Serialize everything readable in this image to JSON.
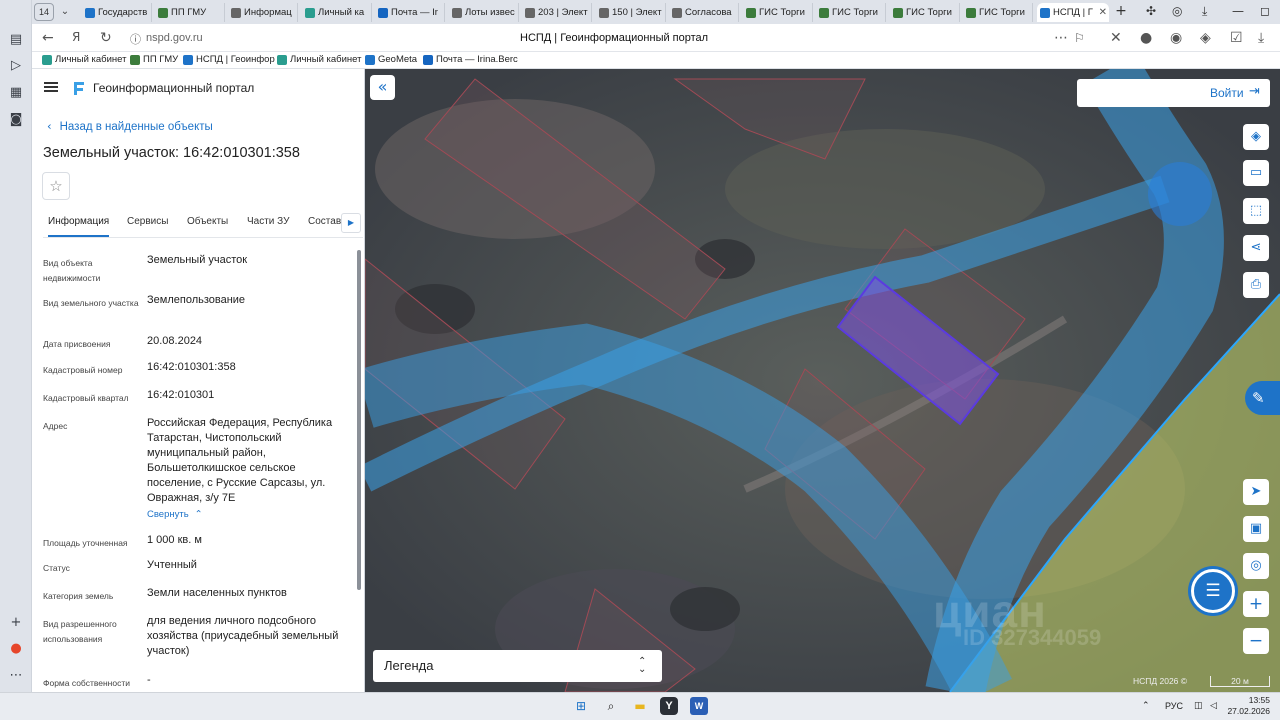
{
  "browser": {
    "tab_count": "14",
    "tabs": [
      {
        "label": "Государств",
        "color": "#1e73c8"
      },
      {
        "label": "ПП ГМУ",
        "color": "#3c7c3c"
      },
      {
        "label": "Информац",
        "color": "#666666"
      },
      {
        "label": "Личный ка",
        "color": "#2a9d8f"
      },
      {
        "label": "Почта — Ir",
        "color": "#1565c0"
      },
      {
        "label": "Лоты извес",
        "color": "#666666"
      },
      {
        "label": "203 | Элект",
        "color": "#666666"
      },
      {
        "label": "150 | Элект",
        "color": "#666666"
      },
      {
        "label": "Согласова",
        "color": "#666666"
      },
      {
        "label": "ГИС Торги",
        "color": "#3c7c3c"
      },
      {
        "label": "ГИС Торги",
        "color": "#3c7c3c"
      },
      {
        "label": "ГИС Торги",
        "color": "#3c7c3c"
      },
      {
        "label": "ГИС Торги",
        "color": "#3c7c3c"
      },
      {
        "label": "НСПД | Г",
        "color": "#1e73c8",
        "active": true
      }
    ],
    "url": "nspd.gov.ru",
    "page_title": "НСПД | Геоинформационный портал",
    "bookmarks": [
      {
        "label": "Личный кабинет",
        "color": "#2a9d8f"
      },
      {
        "label": "ПП ГМУ",
        "color": "#3c7c3c"
      },
      {
        "label": "НСПД | Геоинфор",
        "color": "#1e73c8"
      },
      {
        "label": "Личный кабинет",
        "color": "#2a9d8f"
      },
      {
        "label": "GeoMeta",
        "color": "#1e73c8"
      },
      {
        "label": "Почта — Irina.Berс",
        "color": "#1565c0"
      }
    ]
  },
  "panel": {
    "portal_title": "Геоинформационный портал",
    "back_label": "Назад в найденные объекты",
    "object_title": "Земельный участок: 16:42:010301:358",
    "tabs": [
      "Информация",
      "Сервисы",
      "Объекты",
      "Части ЗУ",
      "Состав"
    ],
    "fields": [
      {
        "key": "Вид объекта недвижимости",
        "value": "Земельный участок"
      },
      {
        "key": "Вид земельного участка",
        "value": "Землепользование"
      },
      {
        "key": "Дата присвоения",
        "value": "20.08.2024"
      },
      {
        "key": "Кадастровый номер",
        "value": "16:42:010301:358"
      },
      {
        "key": "Кадастровый квартал",
        "value": "16:42:010301"
      },
      {
        "key": "Адрес",
        "value": "Российская Федерация, Республика Татарстан, Чистопольский муниципальный район, Большетолкишское сельское поселение, с Русские Сарсазы, ул. Овражная, з/у 7Е"
      },
      {
        "key": "Площадь уточненная",
        "value": "1 000 кв. м"
      },
      {
        "key": "Статус",
        "value": "Учтенный"
      },
      {
        "key": "Категория земель",
        "value": "Земли населенных пунктов"
      },
      {
        "key": "Вид разрешенного использования",
        "value": "для ведения личного подсобного хозяйства (приусадебный земельный участок)"
      },
      {
        "key": "Форма собственности",
        "value": "-"
      }
    ],
    "collapse_label": "Свернуть"
  },
  "map": {
    "login_label": "Войти",
    "legend_label": "Легенда",
    "attribution": "НСПД 2026 ©",
    "scale_label": "20 м",
    "watermark": "циан",
    "watermark_id": "ID 327344059"
  },
  "taskbar": {
    "lang": "РУС",
    "time": "13:55",
    "date": "27.02.2026"
  },
  "colors": {
    "accent": "#1e73c8",
    "selected_parcel": "#7b52e0",
    "water_zone": "#3aa0e6",
    "settlement_zone": "#c9d86a"
  }
}
